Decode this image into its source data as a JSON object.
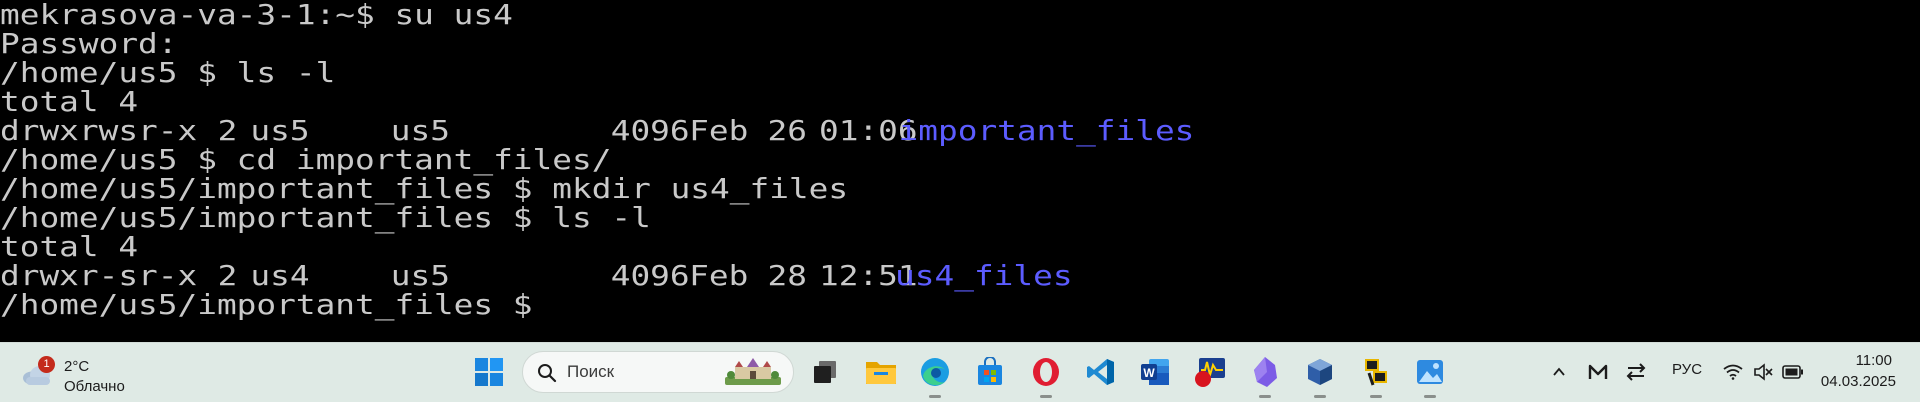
{
  "terminal": {
    "lines": [
      "mekrasova-va-3-1:~$ su us4",
      "Password:",
      "/home/us5 $ ls -l",
      "total 4"
    ],
    "listing1": {
      "perms": "drwxrwsr-x",
      "links": "2",
      "owner": "us5",
      "group": "us5",
      "size": "4096",
      "month": "Feb",
      "day": "26",
      "time": "01:06",
      "name": "important_files"
    },
    "lines2": [
      "/home/us5 $ cd important_files/",
      "/home/us5/important_files $ mkdir us4_files",
      "/home/us5/important_files $ ls -l",
      "total 4"
    ],
    "listing2": {
      "perms": "drwxr-sr-x",
      "links": "2",
      "owner": "us4",
      "group": "us5",
      "size": "4096",
      "month": "Feb",
      "day": "28",
      "time": "12:51",
      "name": "us4_files"
    },
    "prompt": "/home/us5/important_files $",
    "colors": {
      "background": "#000000",
      "text": "#c9c9c9",
      "directory": "#5c5cff"
    }
  },
  "taskbar": {
    "weather": {
      "badge": "1",
      "temperature": "2°C",
      "condition": "Облачно"
    },
    "search": {
      "placeholder": "Поиск"
    },
    "pinned_icons": [
      "windows-start-icon",
      "task-view-icon",
      "file-explorer-icon",
      "edge-icon",
      "microsoft-store-icon",
      "opera-icon",
      "vscode-icon",
      "word-icon",
      "monitor-app-icon",
      "obsidian-icon",
      "virtualbox-icon",
      "putty-icon",
      "photos-icon"
    ],
    "tray": {
      "language": "РУС",
      "time": "11:00",
      "date": "04.03.2025"
    },
    "colors": {
      "background": "#dfeae5",
      "accent": "#0078d4"
    }
  }
}
